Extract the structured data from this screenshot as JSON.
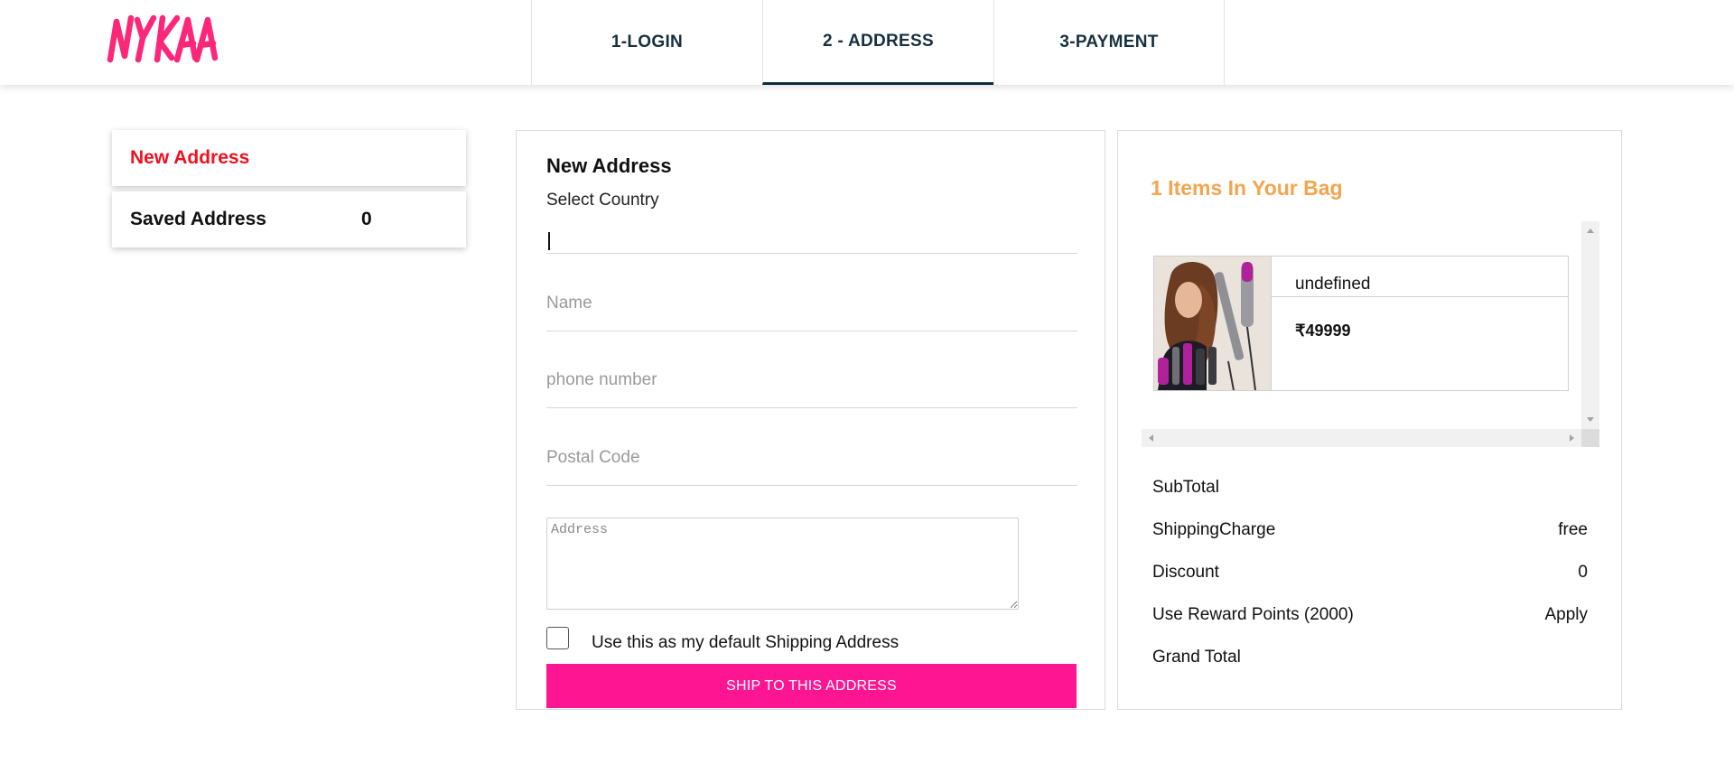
{
  "brand": {
    "logo_text": "NYKAA",
    "accent_color": "#fe1592"
  },
  "steps": [
    {
      "label": "1-LOGIN",
      "active": false
    },
    {
      "label": "2 - ADDRESS",
      "active": true
    },
    {
      "label": "3-PAYMENT",
      "active": false
    }
  ],
  "sidebar": {
    "new_address": "New Address",
    "saved_address": "Saved Address",
    "saved_count": "0"
  },
  "form": {
    "title": "New Address",
    "country_label": "Select Country",
    "country_value": "",
    "name_placeholder": "Name",
    "phone_placeholder": "phone number",
    "postal_placeholder": "Postal Code",
    "address_placeholder": "Address",
    "default_checkbox_label": "Use this as my default Shipping Address",
    "default_checked": false,
    "submit_label": "SHIP TO THIS ADDRESS"
  },
  "bag": {
    "title": "1 Items In Your Bag",
    "items": [
      {
        "name": "undefined",
        "price": "₹49999",
        "image": "hair-styler-product-image"
      }
    ]
  },
  "summary": {
    "subtotal_label": "SubTotal",
    "subtotal_value": "",
    "shipping_label": "ShippingCharge",
    "shipping_value": "free",
    "discount_label": "Discount",
    "discount_value": "0",
    "reward_label": "Use Reward Points (2000)",
    "reward_action": "Apply",
    "grand_total_label": "Grand Total",
    "grand_total_value": ""
  }
}
